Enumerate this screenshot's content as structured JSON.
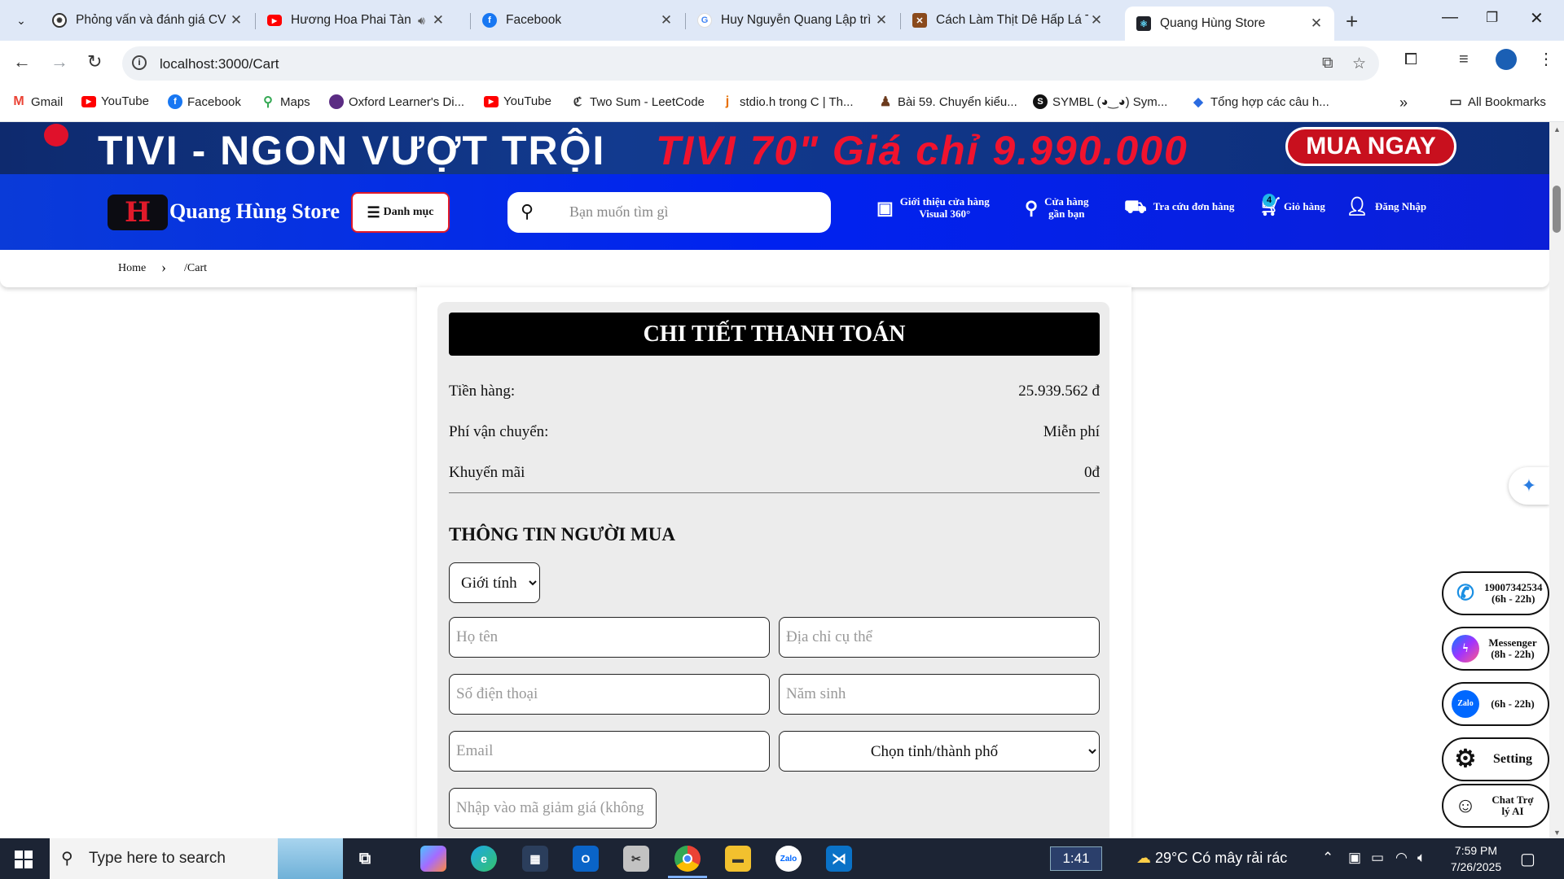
{
  "browser": {
    "tabs": [
      {
        "title": "Phỏng vấn và đánh giá CV",
        "favicon": "openai-icon"
      },
      {
        "title": "Hương Hoa Phai Tàn (T",
        "favicon": "youtube-icon"
      },
      {
        "title": "Facebook",
        "favicon": "facebook-icon"
      },
      {
        "title": "Huy Nguyễn Quang Lập trì",
        "favicon": "google-icon"
      },
      {
        "title": "Cách Làm Thịt Dê Hấp Lá T",
        "favicon": "recipe-icon"
      },
      {
        "title": "Quang Hùng Store",
        "favicon": "react-icon"
      }
    ],
    "url": "localhost:3000/Cart",
    "bookmarks": [
      {
        "label": "Gmail"
      },
      {
        "label": "YouTube"
      },
      {
        "label": "Facebook"
      },
      {
        "label": "Maps"
      },
      {
        "label": "Oxford Learner's Di..."
      },
      {
        "label": "YouTube"
      },
      {
        "label": "Two Sum - LeetCode"
      },
      {
        "label": "stdio.h trong C | Th..."
      },
      {
        "label": "Bài 59. Chuyển kiểu..."
      },
      {
        "label": "SYMBL (◕‿◕) Sym..."
      },
      {
        "label": "Tổng hợp các câu h..."
      }
    ],
    "all_bookmarks": "All Bookmarks"
  },
  "promo": {
    "left_text": "TIVI - NGON VƯỢT TRỘI",
    "right_text": "TIVI 70\" Giá chỉ 9.990.000",
    "cta": "MUA NGAY"
  },
  "header": {
    "logo_letter": "H",
    "brand": "Quang Hùng Store",
    "menu_label": "Danh mục",
    "search_placeholder": "Bạn muốn tìm gì",
    "items": [
      {
        "line1": "Giới thiệu cửa hàng",
        "line2": "Visual 360°"
      },
      {
        "line1": "Cửa hàng",
        "line2": "gần bạn"
      },
      {
        "line1": "Tra cứu đơn hàng",
        "line2": ""
      },
      {
        "line1": "Giỏ hàng",
        "line2": ""
      },
      {
        "line1": "Đăng Nhập",
        "line2": ""
      }
    ],
    "cart_count": "4"
  },
  "breadcrumb": {
    "home": "Home",
    "current": "/Cart"
  },
  "checkout": {
    "title": "CHI TIẾT THANH TOÁN",
    "rows": [
      {
        "label": "Tiền hàng:",
        "value": "25.939.562 đ"
      },
      {
        "label": "Phí vận chuyển:",
        "value": "Miễn phí"
      },
      {
        "label": "Khuyến mãi",
        "value": "0đ"
      }
    ],
    "buyer_title": "THÔNG TIN NGƯỜI MUA",
    "gender_label": "Giới tính",
    "fields": {
      "fullname_placeholder": "Họ tên",
      "address_placeholder": "Địa chỉ cụ thể",
      "phone_placeholder": "Số điện thoại",
      "birthyear_placeholder": "Năm sinh",
      "email_placeholder": "Email",
      "city_label": "Chọn tỉnh/thành phố",
      "coupon_placeholder": "Nhập vào mã giảm giá (không"
    }
  },
  "floating": {
    "hotline": {
      "line1": "19007342534",
      "line2": "(6h - 22h)"
    },
    "messenger": {
      "line1": "Messenger",
      "line2": "(8h - 22h)"
    },
    "zalo": {
      "line1": "(6h - 22h)",
      "icon_text": "Zalo"
    },
    "setting": "Setting",
    "chat": {
      "line1": "Chat Trợ",
      "line2": "lý AI"
    }
  },
  "taskbar": {
    "search_placeholder": "Type here to search",
    "timer": "1:41",
    "weather": "29°C  Có mây rải rác",
    "time": "7:59 PM",
    "date": "7/26/2025"
  }
}
